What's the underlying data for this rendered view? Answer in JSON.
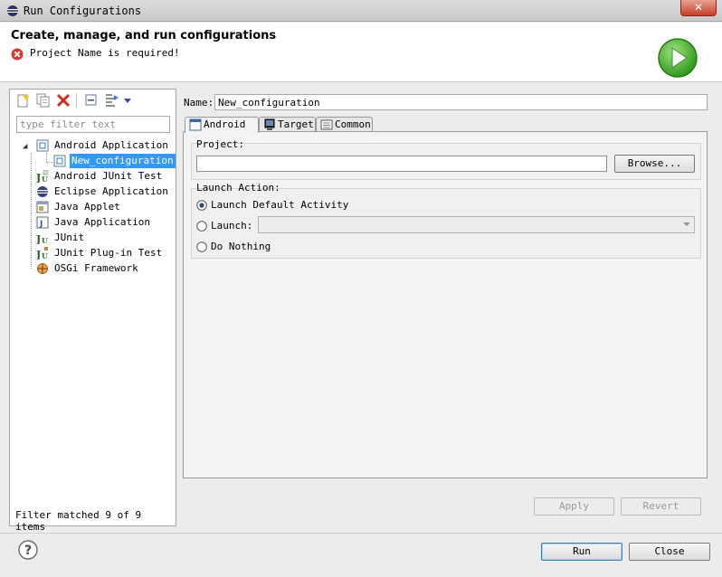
{
  "window": {
    "title": "Run Configurations",
    "close_glyph": "✕"
  },
  "header": {
    "title": "Create, manage, and run configurations",
    "error": "Project Name is required!",
    "error_icon": "error-icon",
    "banner_icon": "run-launch-icon"
  },
  "left": {
    "filter_placeholder": "type filter text",
    "filter_value": "",
    "tree": [
      {
        "label": "Android Application",
        "icon": "android-app-icon",
        "expanded": true
      },
      {
        "label": "New_configuration",
        "icon": "android-config-icon",
        "selected": true
      },
      {
        "label": "Android JUnit Test",
        "icon": "junit-android-icon"
      },
      {
        "label": "Eclipse Application",
        "icon": "eclipse-icon"
      },
      {
        "label": "Java Applet",
        "icon": "java-applet-icon"
      },
      {
        "label": "Java Application",
        "icon": "java-app-icon"
      },
      {
        "label": "JUnit",
        "icon": "junit-icon"
      },
      {
        "label": "JUnit Plug-in Test",
        "icon": "junit-plugin-icon"
      },
      {
        "label": "OSGi Framework",
        "icon": "osgi-icon"
      }
    ],
    "status": "Filter matched 9 of 9 items"
  },
  "config": {
    "name_label": "Name:",
    "name_value": "New_configuration",
    "tabs": [
      {
        "label": "Android",
        "active": true
      },
      {
        "label": "Target"
      },
      {
        "label": "Common"
      }
    ],
    "project_label": "Project:",
    "project_value": "",
    "browse_label": "Browse...",
    "launch_action_label": "Launch Action:",
    "radio_default": "Launch Default Activity",
    "radio_launch": "Launch:",
    "radio_nothing": "Do Nothing",
    "launch_selected": "Launch Default Activity",
    "activity_value": ""
  },
  "buttons": {
    "apply": "Apply",
    "revert": "Revert",
    "run": "Run",
    "close": "Close"
  },
  "colors": {
    "selection": "#3399ff",
    "error": "#d93a2b",
    "run_green": "#3fae2a"
  }
}
